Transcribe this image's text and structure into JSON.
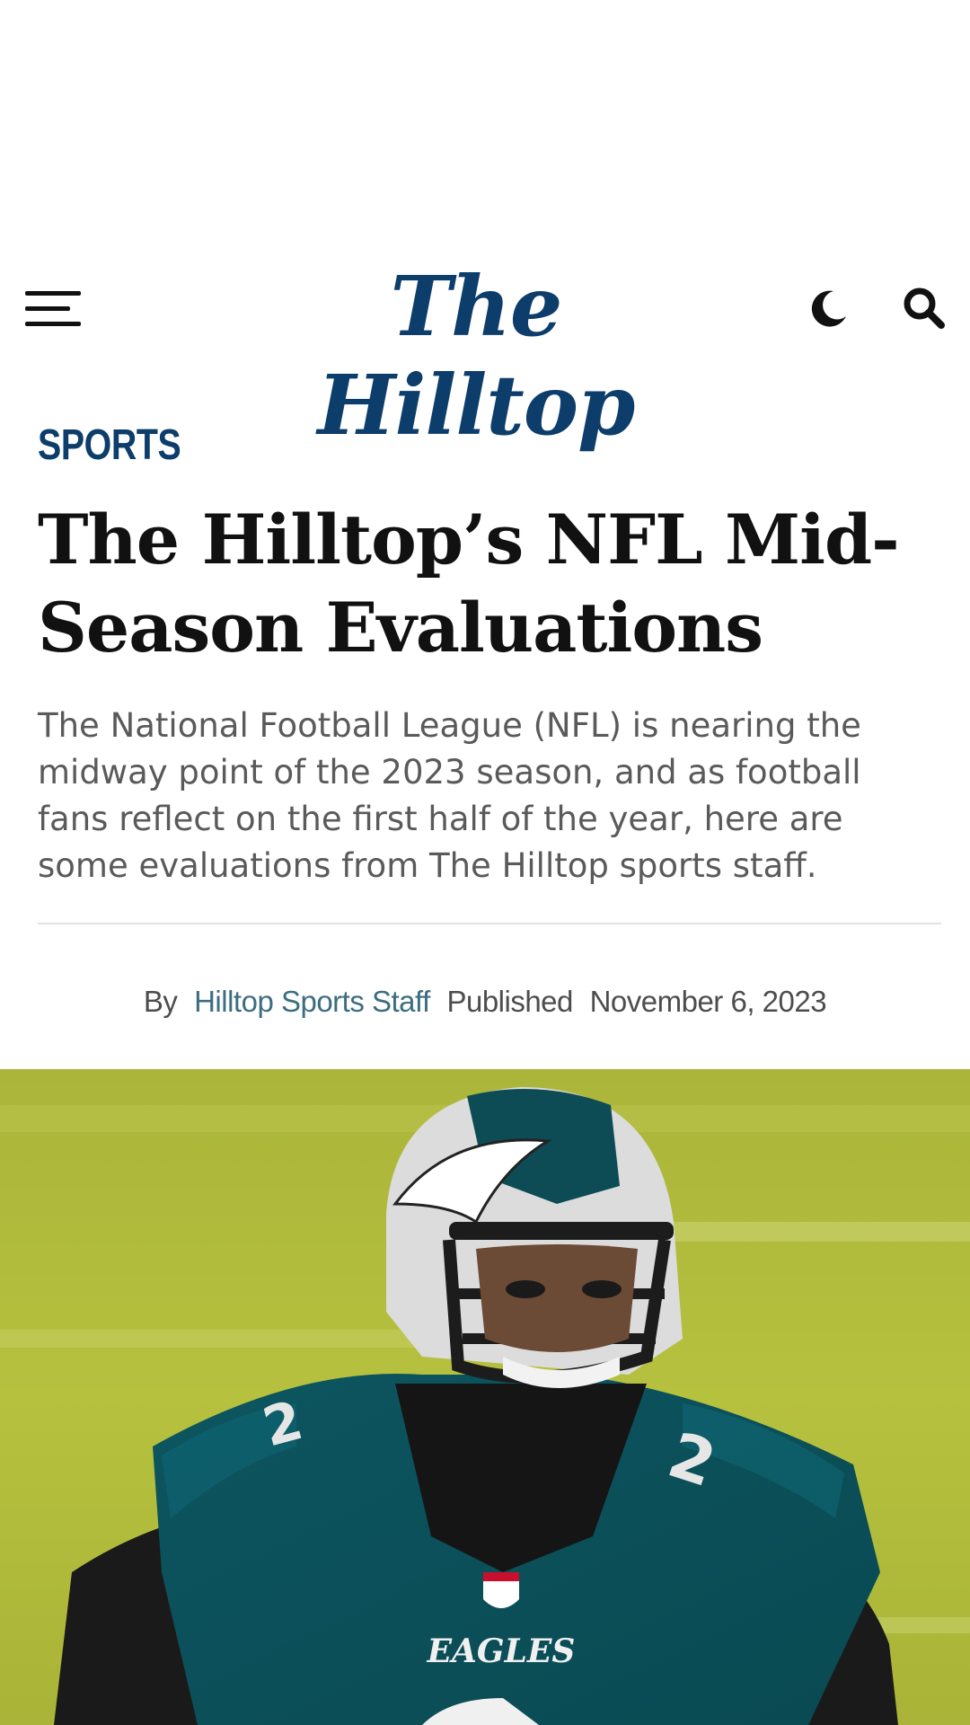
{
  "header": {
    "logo_text": "The Hilltop",
    "menu_icon": "hamburger-menu-icon",
    "dark_mode_icon": "moon-icon",
    "search_icon": "search-icon"
  },
  "article": {
    "category": "SPORTS",
    "title": "The Hilltop’s NFL Mid-Season Evaluations",
    "dek": "The National Football League (NFL) is nearing the midway point of the 2023 season, and as football fans reflect on the first half of the year, here are some evaluations from The Hilltop sports staff.",
    "byline": {
      "by_label": "By",
      "author": "Hilltop Sports Staff",
      "published_label": "Published",
      "date": "November 6, 2023"
    },
    "hero_jersey_text": "EAGLES"
  },
  "colors": {
    "brand_blue": "#0d3d6b",
    "author_link": "#3c6e80",
    "field_green": "#b3bf3a",
    "jersey_teal": "#0f5b66"
  }
}
